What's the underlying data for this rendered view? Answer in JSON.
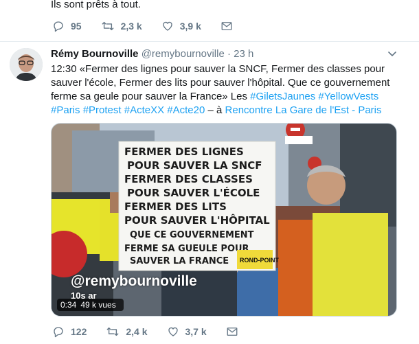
{
  "previous_tweet": {
    "text": "Ils sont prêts à tout.",
    "actions": {
      "replies": "95",
      "retweets": "2,3 k",
      "likes": "3,9 k"
    }
  },
  "tweet": {
    "author_name": "Rémy Bournoville",
    "author_handle": "@remybournoville",
    "separator": "·",
    "time": "23 h",
    "text_lines": {
      "l1": "12:30 «Fermer des lignes pour sauver la SNCF, Fermer des classes pour",
      "l2": "sauver l'école, Fermer des lits pour sauver l'hôpital. Que ce gouvernement",
      "l3": "ferme sa geule pour sauver la France» Les "
    },
    "hashtags": [
      "#GiletsJaunes",
      "#YellowVests",
      "#Paris",
      "#Protest",
      "#ActeXX",
      "#Acte20"
    ],
    "location_prefix": " – à ",
    "location": "Rencontre La Gare de l'Est - Paris",
    "video": {
      "duration": "0:34",
      "views": "49 k vues",
      "watermark": "@remybournoville",
      "watermark_sub": "10s ar"
    },
    "sign": {
      "lines": [
        "FERMER DES LIGNES",
        "POUR SAUVER LA SNCF",
        "FERMER DES CLASSES",
        "POUR SAUVER L'ÉCOLE",
        "FERMER DES LITS",
        "POUR SAUVER L'HÔPITAL",
        "QUE CE GOUVERNEMENT",
        "FERME SA GUEULE POUR",
        "SAUVER LA FRANCE"
      ],
      "tag": "ROND-POINT"
    },
    "actions": {
      "replies": "122",
      "retweets": "2,4 k",
      "likes": "3,7 k"
    }
  },
  "colors": {
    "link": "#1da1f2",
    "secondary_text": "#657786",
    "divider": "#e6ecf0"
  },
  "icons": [
    "reply-icon",
    "retweet-icon",
    "like-icon",
    "message-icon",
    "chevron-down-icon"
  ]
}
